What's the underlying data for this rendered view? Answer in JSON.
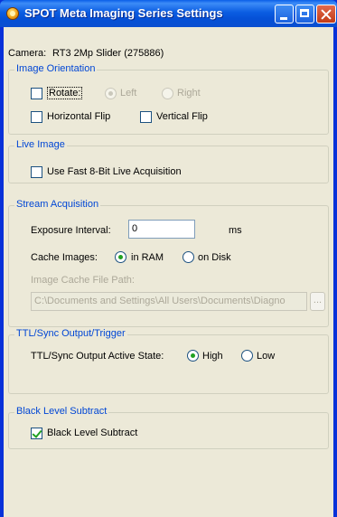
{
  "window": {
    "title": "SPOT Meta Imaging Series Settings"
  },
  "camera": {
    "label": "Camera:",
    "value": "RT3 2Mp Slider (275886)"
  },
  "image_orientation": {
    "title": "Image Orientation",
    "rotate_label": "Rotate:",
    "rotate_checked": false,
    "left_label": "Left",
    "left_selected": true,
    "right_label": "Right",
    "right_selected": false,
    "horizontal_flip_label": "Horizontal Flip",
    "horizontal_flip_checked": false,
    "vertical_flip_label": "Vertical Flip",
    "vertical_flip_checked": false
  },
  "live_image": {
    "title": "Live Image",
    "fast_acq_label": "Use Fast 8-Bit Live Acquisition",
    "fast_acq_checked": false
  },
  "stream_acquisition": {
    "title": "Stream Acquisition",
    "exposure_label": "Exposure Interval:",
    "exposure_value": "0",
    "exposure_unit": "ms",
    "cache_label": "Cache Images:",
    "in_ram_label": "in RAM",
    "in_ram_selected": true,
    "on_disk_label": "on Disk",
    "on_disk_selected": false,
    "cache_path_label": "Image Cache File Path:",
    "cache_path_value": "C:\\Documents and Settings\\All Users\\Documents\\Diagno",
    "browse_label": "..."
  },
  "ttl_sync": {
    "title": "TTL/Sync Output/Trigger",
    "state_label": "TTL/Sync Output Active State:",
    "high_label": "High",
    "high_selected": true,
    "low_label": "Low",
    "low_selected": false
  },
  "black_level": {
    "title": "Black Level Subtract",
    "checkbox_label": "Black Level Subtract",
    "checked": true
  }
}
